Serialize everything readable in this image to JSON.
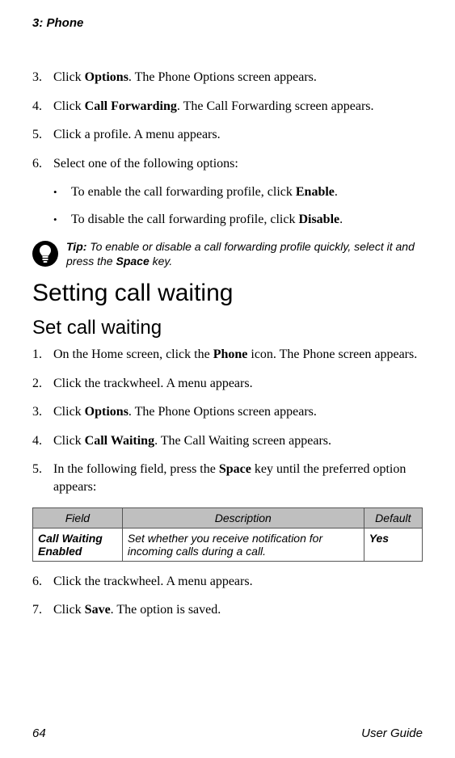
{
  "header": {
    "chapter": "3: Phone"
  },
  "steps_a": [
    {
      "n": "3.",
      "pre": "Click ",
      "b": "Options",
      "post": ". The Phone Options screen appears."
    },
    {
      "n": "4.",
      "pre": "Click ",
      "b": "Call Forwarding",
      "post": ". The Call Forwarding screen appears."
    },
    {
      "n": "5.",
      "pre": "Click a profile. A menu appears.",
      "b": "",
      "post": ""
    },
    {
      "n": "6.",
      "pre": "Select one of the following options:",
      "b": "",
      "post": ""
    }
  ],
  "bullets_a": [
    {
      "pre": "To enable the call forwarding profile, click ",
      "b": "Enable",
      "post": "."
    },
    {
      "pre": "To disable the call forwarding profile, click ",
      "b": "Disable",
      "post": "."
    }
  ],
  "tip": {
    "label": "Tip:",
    "pre": " To enable or disable a call forwarding profile quickly, select it and press the ",
    "key": "Space",
    "post": " key."
  },
  "section_heading": "Setting call waiting",
  "sub_heading": "Set call waiting",
  "steps_b": [
    {
      "n": "1.",
      "pre": "On the Home screen, click the ",
      "b": "Phone",
      "post": " icon. The Phone screen appears."
    },
    {
      "n": "2.",
      "pre": "Click the trackwheel. A menu appears.",
      "b": "",
      "post": ""
    },
    {
      "n": "3.",
      "pre": "Click ",
      "b": "Options",
      "post": ". The Phone Options screen appears."
    },
    {
      "n": "4.",
      "pre": "Click ",
      "b": "Call Waiting",
      "post": ". The Call Waiting screen appears."
    },
    {
      "n": "5.",
      "pre": "In the following field, press the ",
      "b": "Space",
      "post": " key until the preferred option appears:"
    }
  ],
  "table": {
    "headers": {
      "c1": "Field",
      "c2": "Description",
      "c3": "Default"
    },
    "row": {
      "field": "Call Waiting Enabled",
      "desc": "Set whether you receive notification for incoming calls during a call.",
      "def": "Yes"
    }
  },
  "steps_c": [
    {
      "n": "6.",
      "pre": "Click the trackwheel. A menu appears.",
      "b": "",
      "post": ""
    },
    {
      "n": "7.",
      "pre": "Click ",
      "b": "Save",
      "post": ". The option is saved."
    }
  ],
  "footer": {
    "page": "64",
    "label": "User Guide"
  }
}
